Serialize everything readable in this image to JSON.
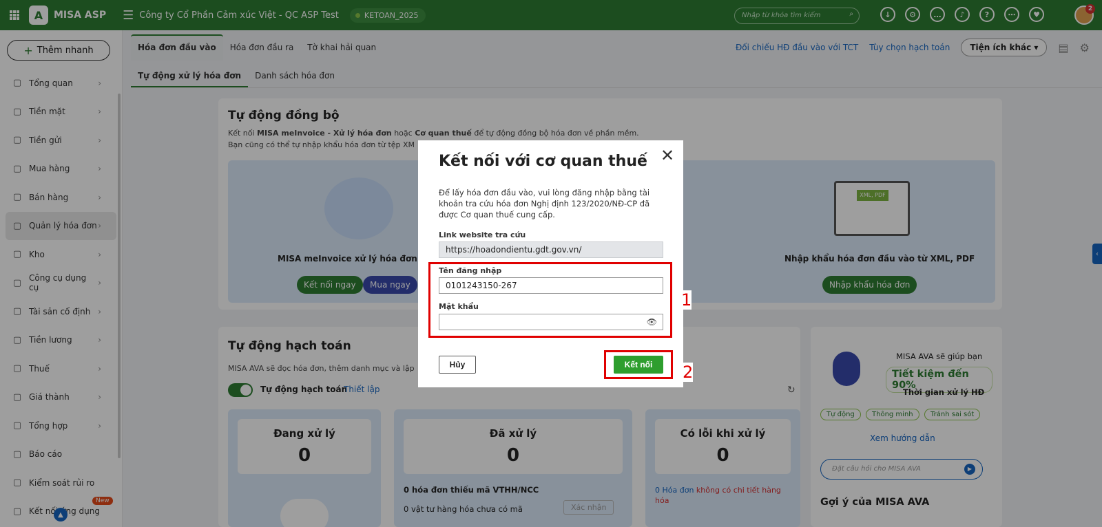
{
  "topbar": {
    "app_name": "MISA ASP",
    "company": "Công ty Cổ Phần Cảm xúc Việt - QC ASP Test",
    "database": "KETOAN_2025",
    "search_placeholder": "Nhập từ khóa tìm kiếm",
    "notification_count": "2"
  },
  "sidebar": {
    "quick_add": "Thêm nhanh",
    "items": [
      {
        "label": "Tổng quan",
        "icon": "chart-icon"
      },
      {
        "label": "Tiền mặt",
        "icon": "cash-bag-icon"
      },
      {
        "label": "Tiền gửi",
        "icon": "bank-icon"
      },
      {
        "label": "Mua hàng",
        "icon": "shopping-bag-icon"
      },
      {
        "label": "Bán hàng",
        "icon": "cart-icon"
      },
      {
        "label": "Quản lý hóa đơn",
        "icon": "invoice-icon"
      },
      {
        "label": "Kho",
        "icon": "warehouse-icon"
      },
      {
        "label": "Công cụ dụng cụ",
        "icon": "tools-icon"
      },
      {
        "label": "Tài sản cố định",
        "icon": "asset-icon"
      },
      {
        "label": "Tiền lương",
        "icon": "salary-icon"
      },
      {
        "label": "Thuế",
        "icon": "tax-icon"
      },
      {
        "label": "Giá thành",
        "icon": "price-tag-icon"
      },
      {
        "label": "Tổng hợp",
        "icon": "summary-icon"
      },
      {
        "label": "Báo cáo",
        "icon": "report-icon"
      },
      {
        "label": "Kiểm soát rủi ro",
        "icon": "risk-icon"
      },
      {
        "label": "Kết nối ứng dụng",
        "icon": "connect-icon"
      }
    ],
    "new_badge": "New"
  },
  "tabs": {
    "main": [
      "Hóa đơn đầu vào",
      "Hóa đơn đầu ra",
      "Tờ khai hải quan"
    ],
    "sub": [
      "Tự động xử lý hóa đơn",
      "Danh sách hóa đơn"
    ],
    "links": [
      "Đối chiếu HĐ đầu vào với TCT",
      "Tùy chọn hạch toán"
    ],
    "more": "Tiện ích khác"
  },
  "sync": {
    "title": "Tự động đồng bộ",
    "desc1_a": "Kết nối ",
    "desc1_b": "MISA meInvoice - Xử lý hóa đơn",
    "desc1_c": " hoặc ",
    "desc1_d": "Cơ quan thuế",
    "desc1_e": " để tự động đồng bộ hóa đơn về phần mềm.",
    "desc2": "Bạn cũng có thể tự nhập khẩu hóa đơn từ tệp XM",
    "panel1_title": "MISA meInvoice xử lý hóa đơn đầu v",
    "btn_connect_now": "Kết nối ngay",
    "btn_buy_now": "Mua ngay",
    "panel3_title": "Nhập khẩu hóa đơn đầu vào từ XML, PDF",
    "btn_import": "Nhập khẩu hóa đơn",
    "file_label": "XML, PDF"
  },
  "auto": {
    "title": "Tự động hạch toán",
    "desc": "MISA AVA sẽ đọc hóa đơn, thêm danh mục và lập",
    "toggle_label": "Tự động hạch toán",
    "setup_link": "Thiết lập",
    "stats": [
      {
        "title": "Đang xử lý",
        "value": "0"
      },
      {
        "title": "Đã xử lý",
        "value": "0"
      },
      {
        "title": "Có lỗi khi xử lý",
        "value": "0"
      }
    ],
    "missing_code": "0 hóa đơn thiếu mã VTHH/NCC",
    "no_code_items": "0 vật tư hàng hóa chưa có mã",
    "confirm_btn": "Xác nhận",
    "err_a": "0 Hóa đơn",
    "err_b": " không có chi tiết hàng hóa"
  },
  "ava": {
    "help": "MISA AVA sẽ giúp bạn",
    "save": "Tiết kiệm đến 90%",
    "time": "Thời gian xử lý HĐ",
    "chips": [
      "Tự động",
      "Thông minh",
      "Tránh sai sót"
    ],
    "guide": "Xem hướng dẫn",
    "ask_placeholder": "Đặt câu hỏi cho MISA AVA",
    "suggest": "Gợi ý của MISA AVA"
  },
  "modal": {
    "title": "Kết nối với cơ quan thuế",
    "desc": "Để lấy hóa đơn đầu vào, vui lòng đăng nhập bằng tài khoản tra cứu hóa đơn Nghị định 123/2020/NĐ-CP đã được Cơ quan thuế cung cấp.",
    "link_label": "Link website tra cứu",
    "link_value": "https://hoadondientu.gdt.gov.vn/",
    "user_label": "Tên đăng nhập",
    "user_value": "0101243150-267",
    "pass_label": "Mật khẩu",
    "pass_value": "",
    "cancel": "Hủy",
    "connect": "Kết nối"
  },
  "annotations": {
    "box1": "1",
    "box2": "2"
  },
  "colors": {
    "brand": "#2e7d32",
    "highlight": "#e00000",
    "link": "#1565c0"
  }
}
